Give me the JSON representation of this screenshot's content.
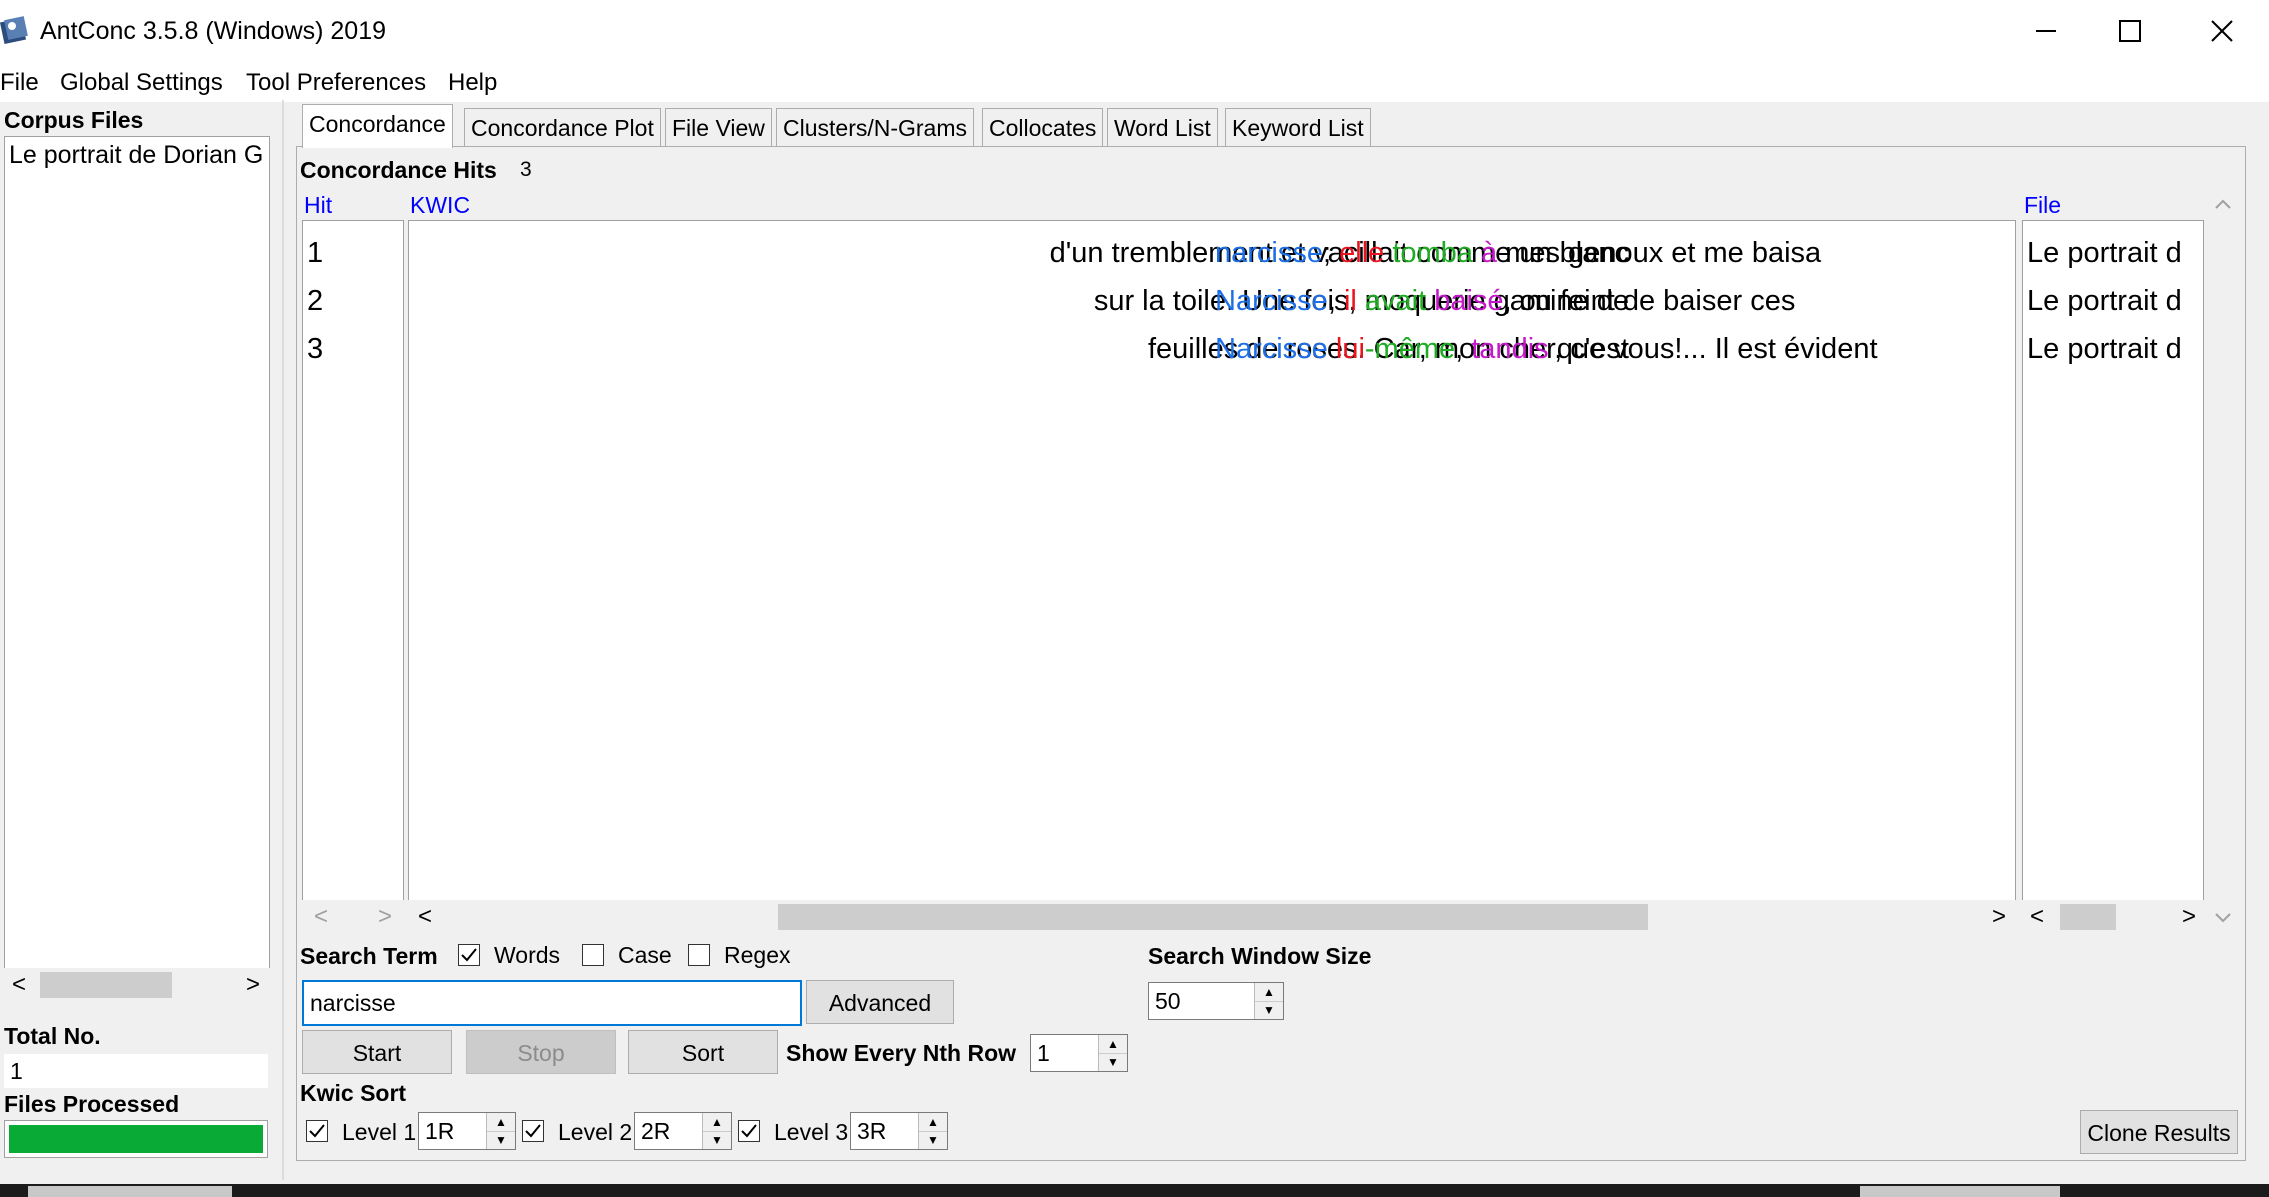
{
  "window": {
    "title": "AntConc 3.5.8 (Windows) 2019"
  },
  "menu": [
    "File",
    "Global Settings",
    "Tool Preferences",
    "Help"
  ],
  "left_panel": {
    "corpus_files_label": "Corpus Files",
    "corpus_files": [
      "Le portrait de Dorian G"
    ],
    "total_no_label": "Total No.",
    "total_no_value": "1",
    "files_processed_label": "Files Processed",
    "files_processed_progress": 1.0,
    "progress_color": "#0aaa36"
  },
  "tabs": [
    "Concordance",
    "Concordance Plot",
    "File View",
    "Clusters/N-Grams",
    "Collocates",
    "Word List",
    "Keyword List"
  ],
  "active_tab": "Concordance",
  "concordance": {
    "hits_label": "Concordance Hits",
    "hits_value": "3",
    "col_hit": "Hit",
    "col_kwic": "KWIC",
    "col_file": "File",
    "rows": [
      {
        "hit": "1",
        "left": "d'un tremblement et vacillait comme un blanc",
        "kw": "narcisse",
        "p1": ";",
        "r1": "elle",
        "r2": "tomba",
        "r3": "à",
        "rest": "mes genoux et me baisa",
        "file": "Le portrait d"
      },
      {
        "hit": "2",
        "left": "sur la toile. Une fois, moquerie gamine de",
        "kw": "Narcisse",
        "p1": ",",
        "r1": "il",
        "r2": "avait",
        "r3": "baisé",
        "rest": ", ou feint de baiser ces",
        "file": "Le portrait d"
      },
      {
        "hit": "3",
        "left": "feuilles de roses. Car, mon cher, c'est",
        "kw": "Narcisse",
        "p1": "",
        "r1": "lui",
        "r2": "-même",
        "r3": "tandis",
        "rest": "que vous!... Il est évident",
        "file": "Le portrait d"
      }
    ]
  },
  "search": {
    "term_label": "Search Term",
    "words_label": "Words",
    "words_checked": true,
    "case_label": "Case",
    "case_checked": false,
    "regex_label": "Regex",
    "regex_checked": false,
    "term_value": "narcisse",
    "advanced_label": "Advanced",
    "start_label": "Start",
    "stop_label": "Stop",
    "sort_label": "Sort",
    "nth_row_label": "Show Every Nth Row",
    "nth_row_value": "1",
    "window_size_label": "Search Window Size",
    "window_size_value": "50"
  },
  "kwic_sort": {
    "label": "Kwic Sort",
    "levels": [
      {
        "label": "Level 1",
        "value": "1R",
        "checked": true
      },
      {
        "label": "Level 2",
        "value": "2R",
        "checked": true
      },
      {
        "label": "Level 3",
        "value": "3R",
        "checked": true
      }
    ]
  },
  "clone_results_label": "Clone Results",
  "icons": {
    "app": "antconc-app-icon",
    "minimize": "minimize-icon",
    "maximize": "maximize-icon",
    "close": "close-icon"
  }
}
